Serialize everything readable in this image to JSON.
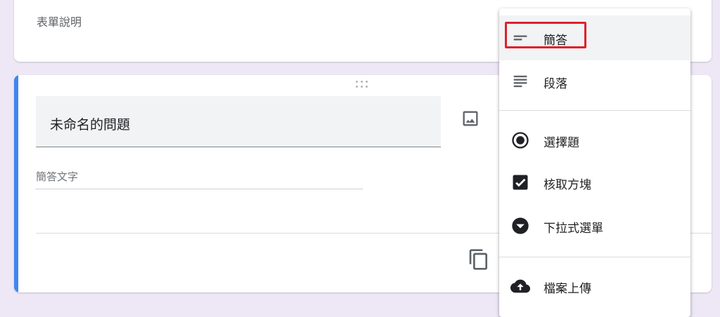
{
  "form": {
    "description_label": "表單說明"
  },
  "question": {
    "title": "未命名的問題",
    "answer_placeholder": "簡答文字"
  },
  "type_menu": {
    "items": [
      {
        "label": "簡答",
        "icon": "short-answer-icon",
        "selected": true
      },
      {
        "label": "段落",
        "icon": "paragraph-icon"
      },
      {
        "label": "選擇題",
        "icon": "radio-button-icon"
      },
      {
        "label": "核取方塊",
        "icon": "checkbox-icon"
      },
      {
        "label": "下拉式選單",
        "icon": "dropdown-icon"
      },
      {
        "label": "檔案上傳",
        "icon": "cloud-upload-icon"
      }
    ]
  },
  "colors": {
    "accent": "#4285f4",
    "highlight": "#e0202c",
    "background": "#ede7f6"
  }
}
